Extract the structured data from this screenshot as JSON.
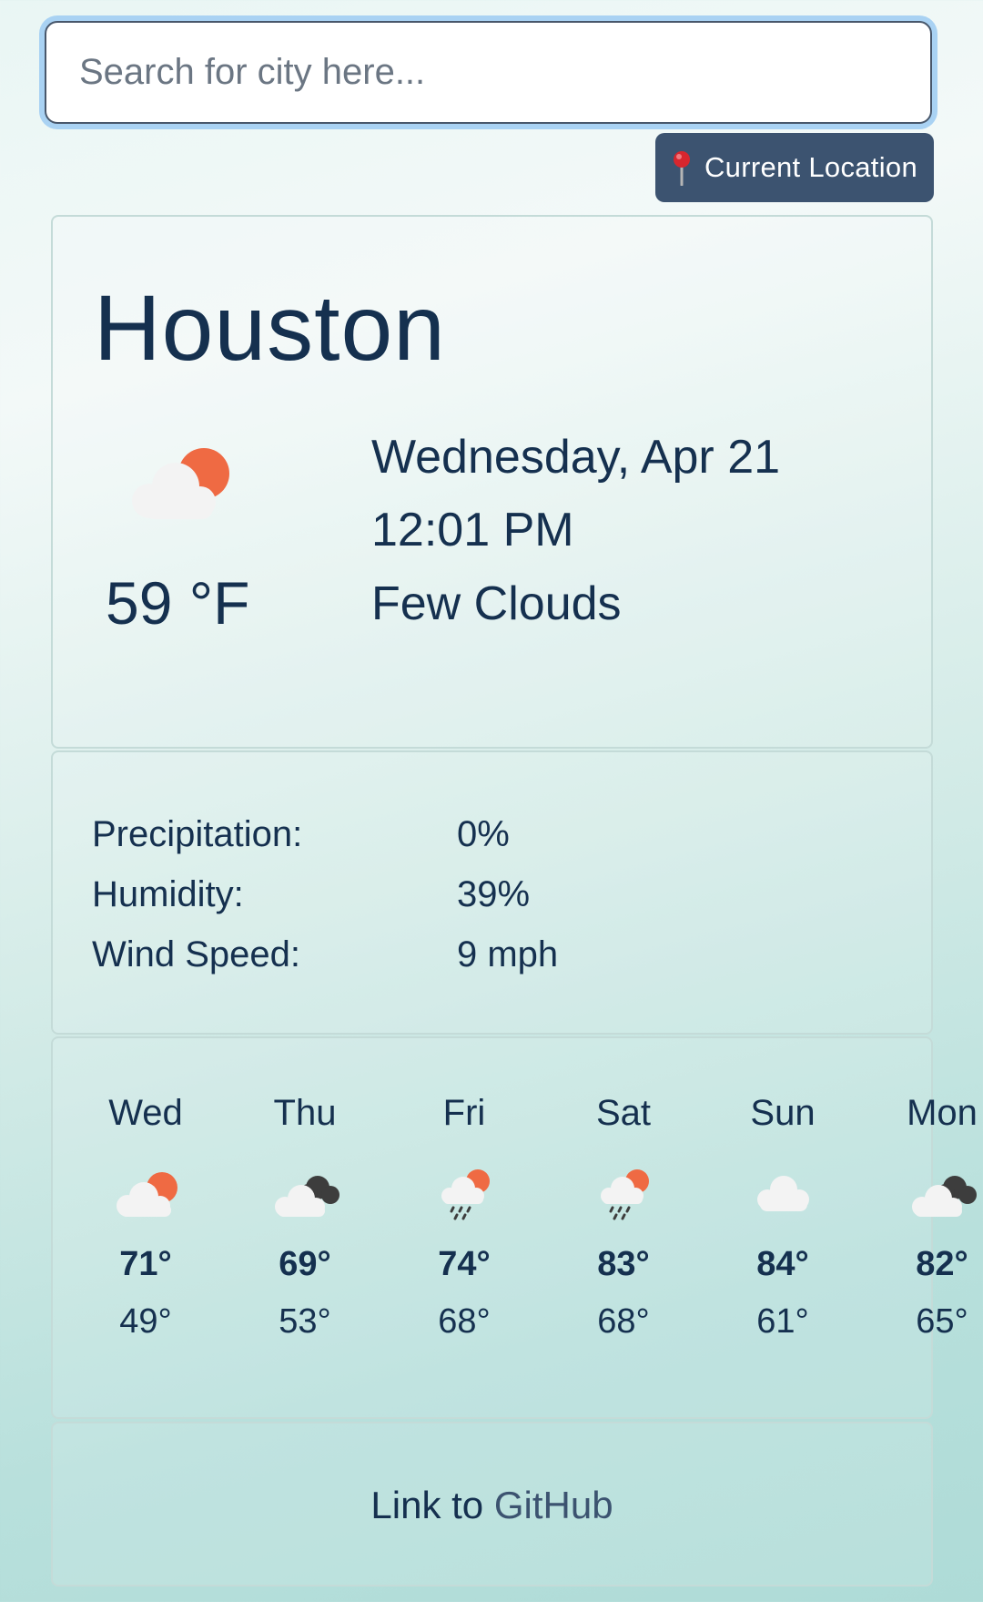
{
  "search": {
    "placeholder": "Search for city here..."
  },
  "location_button": {
    "label": "Current Location",
    "icon": "map-pin-icon"
  },
  "current": {
    "city": "Houston",
    "temperature": "59 °F",
    "date": "Wednesday, Apr 21",
    "time": "12:01 PM",
    "condition": "Few Clouds",
    "icon": "few-clouds-icon"
  },
  "details": [
    {
      "label": "Precipitation:",
      "value": "0%"
    },
    {
      "label": "Humidity:",
      "value": "39%"
    },
    {
      "label": "Wind Speed:",
      "value": "9 mph"
    }
  ],
  "forecast": [
    {
      "day": "Wed",
      "high": "71°",
      "low": "49°",
      "icon": "few-clouds-icon"
    },
    {
      "day": "Thu",
      "high": "69°",
      "low": "53°",
      "icon": "broken-clouds-icon"
    },
    {
      "day": "Fri",
      "high": "74°",
      "low": "68°",
      "icon": "rain-sun-icon"
    },
    {
      "day": "Sat",
      "high": "83°",
      "low": "68°",
      "icon": "rain-sun-icon"
    },
    {
      "day": "Sun",
      "high": "84°",
      "low": "61°",
      "icon": "cloud-icon"
    },
    {
      "day": "Mon",
      "high": "82°",
      "low": "65°",
      "icon": "broken-clouds-icon"
    }
  ],
  "footer": {
    "text": "Link to",
    "link": "GitHub"
  },
  "colors": {
    "accent": "#3c5370",
    "text": "#15304f",
    "sun": "#ef6a43",
    "cloud": "#f3f3f3",
    "dark_cloud": "#3d3d3d"
  }
}
